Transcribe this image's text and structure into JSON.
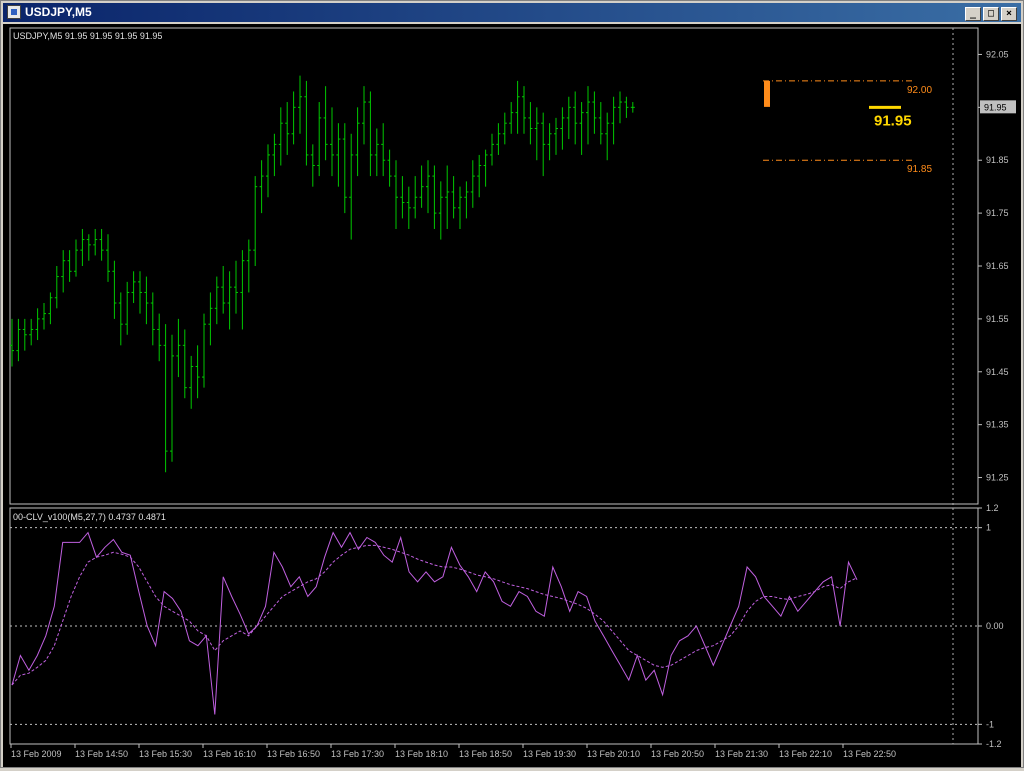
{
  "window": {
    "title": "USDJPY,M5",
    "buttons": {
      "minimize": "_",
      "maximize": "□",
      "close": "×"
    }
  },
  "colors": {
    "background": "#000000",
    "bars": "#00c800",
    "grid": "#c0c0c0",
    "fore": "#c0c0c0",
    "indicator": "#c060e0",
    "signal": "#c060e0",
    "level": "#ff8c1a",
    "bigprice": "#ffd700",
    "pricebox": "#c0c0c0"
  },
  "main_chart": {
    "header": "USDJPY,M5  91.95 91.95 91.95 91.95",
    "price_ticks": [
      "92.05",
      "91.95",
      "91.85",
      "91.75",
      "91.65",
      "91.55",
      "91.45",
      "91.35",
      "91.25"
    ],
    "current_price_box": "91.95",
    "big_price_label": "91.95",
    "level_upper": "92.00",
    "level_lower": "91.85"
  },
  "sub_chart": {
    "header": "00-CLV_v100(M5,27,7) 0.4737 0.4871",
    "ticks": [
      "1.2",
      "1",
      "0.00",
      "-1",
      "-1.2"
    ]
  },
  "time_labels": [
    "13 Feb 2009",
    "13 Feb 14:50",
    "13 Feb 15:30",
    "13 Feb 16:10",
    "13 Feb 16:50",
    "13 Feb 17:30",
    "13 Feb 18:10",
    "13 Feb 18:50",
    "13 Feb 19:30",
    "13 Feb 20:10",
    "13 Feb 20:50",
    "13 Feb 21:30",
    "13 Feb 22:10",
    "13 Feb 22:50"
  ],
  "chart_data": [
    {
      "type": "ohlc",
      "title": "USDJPY,M5",
      "ylim": [
        91.2,
        92.1
      ],
      "series": [
        {
          "values": [
            [
              91.5,
              91.55,
              91.46,
              91.49
            ],
            [
              91.49,
              91.55,
              91.47,
              91.53
            ],
            [
              91.53,
              91.55,
              91.49,
              91.52
            ],
            [
              91.52,
              91.55,
              91.5,
              91.53
            ],
            [
              91.53,
              91.57,
              91.51,
              91.55
            ],
            [
              91.55,
              91.58,
              91.53,
              91.56
            ],
            [
              91.56,
              91.6,
              91.54,
              91.59
            ],
            [
              91.59,
              91.65,
              91.57,
              91.63
            ],
            [
              91.63,
              91.68,
              91.6,
              91.66
            ],
            [
              91.66,
              91.68,
              91.62,
              91.64
            ],
            [
              91.64,
              91.7,
              91.63,
              91.68
            ],
            [
              91.68,
              91.72,
              91.65,
              91.7
            ],
            [
              91.7,
              91.71,
              91.66,
              91.69
            ],
            [
              91.69,
              91.72,
              91.67,
              91.7
            ],
            [
              91.7,
              91.72,
              91.66,
              91.68
            ],
            [
              91.68,
              91.71,
              91.62,
              91.64
            ],
            [
              91.64,
              91.66,
              91.55,
              91.58
            ],
            [
              91.58,
              91.6,
              91.5,
              91.54
            ],
            [
              91.54,
              91.62,
              91.52,
              91.6
            ],
            [
              91.6,
              91.64,
              91.58,
              91.62
            ],
            [
              91.62,
              91.64,
              91.56,
              91.6
            ],
            [
              91.6,
              91.63,
              91.54,
              91.58
            ],
            [
              91.58,
              91.6,
              91.5,
              91.53
            ],
            [
              91.53,
              91.56,
              91.47,
              91.5
            ],
            [
              91.5,
              91.54,
              91.26,
              91.3
            ],
            [
              91.3,
              91.52,
              91.28,
              91.48
            ],
            [
              91.48,
              91.55,
              91.44,
              91.5
            ],
            [
              91.5,
              91.53,
              91.4,
              91.42
            ],
            [
              91.42,
              91.48,
              91.38,
              91.46
            ],
            [
              91.46,
              91.5,
              91.4,
              91.44
            ],
            [
              91.44,
              91.56,
              91.42,
              91.54
            ],
            [
              91.54,
              91.6,
              91.5,
              91.57
            ],
            [
              91.57,
              91.63,
              91.54,
              91.61
            ],
            [
              91.61,
              91.65,
              91.56,
              91.58
            ],
            [
              91.58,
              91.64,
              91.53,
              91.61
            ],
            [
              91.61,
              91.66,
              91.56,
              91.6
            ],
            [
              91.6,
              91.68,
              91.53,
              91.66
            ],
            [
              91.66,
              91.7,
              91.6,
              91.68
            ],
            [
              91.68,
              91.82,
              91.65,
              91.8
            ],
            [
              91.8,
              91.85,
              91.75,
              91.82
            ],
            [
              91.82,
              91.88,
              91.78,
              91.86
            ],
            [
              91.86,
              91.9,
              91.82,
              91.88
            ],
            [
              91.88,
              91.95,
              91.84,
              91.92
            ],
            [
              91.92,
              91.96,
              91.86,
              91.9
            ],
            [
              91.9,
              91.98,
              91.88,
              91.95
            ],
            [
              91.95,
              92.01,
              91.9,
              91.97
            ],
            [
              91.97,
              92.0,
              91.84,
              91.86
            ],
            [
              91.86,
              91.88,
              91.8,
              91.84
            ],
            [
              91.84,
              91.96,
              91.82,
              91.93
            ],
            [
              91.93,
              91.99,
              91.85,
              91.88
            ],
            [
              91.88,
              91.95,
              91.82,
              91.86
            ],
            [
              91.86,
              91.92,
              91.8,
              91.89
            ],
            [
              91.89,
              91.92,
              91.75,
              91.78
            ],
            [
              91.78,
              91.9,
              91.7,
              91.86
            ],
            [
              91.86,
              91.95,
              91.82,
              91.92
            ],
            [
              91.92,
              91.99,
              91.88,
              91.96
            ],
            [
              91.96,
              91.98,
              91.82,
              91.86
            ],
            [
              91.86,
              91.91,
              91.82,
              91.88
            ],
            [
              91.88,
              91.92,
              91.82,
              91.85
            ],
            [
              91.85,
              91.87,
              91.8,
              91.82
            ],
            [
              91.82,
              91.85,
              91.72,
              91.78
            ],
            [
              91.78,
              91.82,
              91.74,
              91.77
            ],
            [
              91.77,
              91.8,
              91.72,
              91.76
            ],
            [
              91.76,
              91.82,
              91.74,
              91.78
            ],
            [
              91.78,
              91.84,
              91.76,
              91.8
            ],
            [
              91.8,
              91.85,
              91.75,
              91.82
            ],
            [
              91.82,
              91.84,
              91.72,
              91.75
            ],
            [
              91.75,
              91.81,
              91.7,
              91.78
            ],
            [
              91.78,
              91.84,
              91.72,
              91.79
            ],
            [
              91.79,
              91.82,
              91.74,
              91.76
            ],
            [
              91.76,
              91.8,
              91.72,
              91.78
            ],
            [
              91.78,
              91.81,
              91.74,
              91.79
            ],
            [
              91.79,
              91.85,
              91.76,
              91.82
            ],
            [
              91.82,
              91.86,
              91.78,
              91.84
            ],
            [
              91.84,
              91.87,
              91.8,
              91.86
            ],
            [
              91.86,
              91.9,
              91.84,
              91.88
            ],
            [
              91.88,
              91.92,
              91.86,
              91.9
            ],
            [
              91.9,
              91.94,
              91.88,
              91.92
            ],
            [
              91.92,
              91.96,
              91.9,
              91.94
            ],
            [
              91.94,
              92.0,
              91.9,
              91.97
            ],
            [
              91.97,
              91.99,
              91.9,
              91.93
            ],
            [
              91.93,
              91.96,
              91.88,
              91.91
            ],
            [
              91.91,
              91.95,
              91.85,
              91.92
            ],
            [
              91.92,
              91.94,
              91.82,
              91.88
            ],
            [
              91.88,
              91.92,
              91.85,
              91.9
            ],
            [
              91.9,
              91.93,
              91.86,
              91.91
            ],
            [
              91.91,
              91.95,
              91.87,
              91.93
            ],
            [
              91.93,
              91.97,
              91.89,
              91.95
            ],
            [
              91.95,
              91.98,
              91.88,
              91.92
            ],
            [
              91.92,
              91.96,
              91.86,
              91.94
            ],
            [
              91.94,
              91.99,
              91.88,
              91.96
            ],
            [
              91.96,
              91.98,
              91.9,
              91.93
            ],
            [
              91.93,
              91.96,
              91.88,
              91.9
            ],
            [
              91.9,
              91.94,
              91.85,
              91.92
            ],
            [
              91.92,
              91.97,
              91.88,
              91.95
            ],
            [
              91.95,
              91.98,
              91.92,
              91.96
            ],
            [
              91.96,
              91.97,
              91.93,
              91.95
            ],
            [
              91.95,
              91.96,
              91.94,
              91.95
            ]
          ]
        }
      ]
    },
    {
      "type": "line",
      "title": "00-CLV_v100(M5,27,7)",
      "ylim": [
        -1.2,
        1.2
      ],
      "series": [
        {
          "name": "CLV",
          "values": [
            -0.6,
            -0.3,
            -0.45,
            -0.3,
            -0.1,
            0.2,
            0.85,
            0.85,
            0.85,
            0.95,
            0.7,
            0.8,
            0.88,
            0.75,
            0.72,
            0.35,
            0.0,
            -0.2,
            0.35,
            0.28,
            0.15,
            -0.15,
            -0.2,
            -0.1,
            -0.9,
            0.5,
            0.3,
            0.12,
            -0.08,
            0.0,
            0.2,
            0.75,
            0.6,
            0.4,
            0.5,
            0.3,
            0.4,
            0.7,
            0.95,
            0.8,
            0.95,
            0.78,
            0.9,
            0.85,
            0.72,
            0.65,
            0.9,
            0.55,
            0.45,
            0.55,
            0.45,
            0.5,
            0.8,
            0.62,
            0.5,
            0.35,
            0.55,
            0.45,
            0.25,
            0.2,
            0.35,
            0.3,
            0.15,
            0.1,
            0.6,
            0.4,
            0.15,
            0.35,
            0.3,
            0.05,
            -0.1,
            -0.25,
            -0.4,
            -0.55,
            -0.3,
            -0.55,
            -0.45,
            -0.7,
            -0.3,
            -0.15,
            -0.1,
            0.0,
            -0.2,
            -0.4,
            -0.2,
            0.0,
            0.2,
            0.6,
            0.5,
            0.3,
            0.2,
            0.1,
            0.3,
            0.15,
            0.25,
            0.35,
            0.45,
            0.5,
            0.0,
            0.65,
            0.47
          ]
        },
        {
          "name": "Signal",
          "values": [
            -0.6,
            -0.5,
            -0.48,
            -0.42,
            -0.35,
            -0.2,
            0.05,
            0.3,
            0.5,
            0.65,
            0.7,
            0.72,
            0.75,
            0.73,
            0.7,
            0.6,
            0.45,
            0.3,
            0.2,
            0.15,
            0.1,
            0.05,
            -0.05,
            -0.1,
            -0.25,
            -0.15,
            -0.1,
            -0.05,
            -0.1,
            0.0,
            0.1,
            0.2,
            0.3,
            0.35,
            0.4,
            0.45,
            0.48,
            0.55,
            0.65,
            0.72,
            0.78,
            0.8,
            0.82,
            0.82,
            0.8,
            0.78,
            0.75,
            0.72,
            0.68,
            0.65,
            0.62,
            0.6,
            0.6,
            0.58,
            0.55,
            0.52,
            0.5,
            0.48,
            0.45,
            0.42,
            0.4,
            0.38,
            0.35,
            0.32,
            0.3,
            0.28,
            0.25,
            0.22,
            0.18,
            0.12,
            0.05,
            -0.05,
            -0.15,
            -0.25,
            -0.3,
            -0.35,
            -0.4,
            -0.42,
            -0.4,
            -0.35,
            -0.3,
            -0.25,
            -0.22,
            -0.2,
            -0.15,
            -0.1,
            0.0,
            0.15,
            0.25,
            0.3,
            0.3,
            0.28,
            0.27,
            0.3,
            0.32,
            0.35,
            0.4,
            0.42,
            0.38,
            0.45,
            0.49
          ]
        }
      ]
    }
  ]
}
